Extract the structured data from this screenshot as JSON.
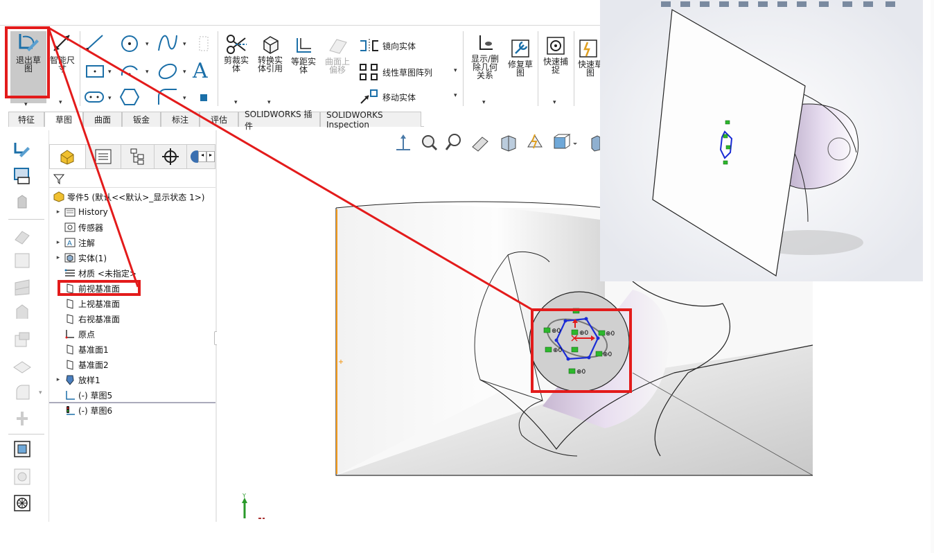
{
  "ribbon": {
    "exit_sketch": "退出草图",
    "smart_dimension": "智能尺寸",
    "trim": "剪裁实体",
    "convert": "转换实体引用",
    "offset": "等距实体",
    "offset_on_surface": "曲面上偏移",
    "mirror": "镜向实体",
    "linear_pattern": "线性草图阵列",
    "move": "移动实体",
    "show_delete_relations": "显示/删除几何关系",
    "repair_sketch": "修复草图",
    "quick_snaps": "快速捕捉",
    "rapid_sketch": "快速草图"
  },
  "tabs": [
    "特征",
    "草图",
    "曲面",
    "钣金",
    "标注",
    "评估",
    "SOLIDWORKS 插件",
    "SOLIDWORKS Inspection"
  ],
  "active_tab": "草图",
  "tree": {
    "root": "零件5  (默认<<默认>_显示状态 1>)",
    "items": [
      {
        "label": "History",
        "arrow": true
      },
      {
        "label": "传感器",
        "arrow": false
      },
      {
        "label": "注解",
        "arrow": true
      },
      {
        "label": "实体(1)",
        "arrow": true
      },
      {
        "label": "材质 <未指定>",
        "arrow": false
      },
      {
        "label": "前视基准面",
        "arrow": false
      },
      {
        "label": "上视基准面",
        "arrow": false
      },
      {
        "label": "右视基准面",
        "arrow": false
      },
      {
        "label": "原点",
        "arrow": false
      },
      {
        "label": "基准面1",
        "arrow": false
      },
      {
        "label": "基准面2",
        "arrow": false
      },
      {
        "label": "放样1",
        "arrow": true
      },
      {
        "label": "(-) 草图5",
        "arrow": false
      },
      {
        "label": "(-) 草图6",
        "arrow": false
      }
    ]
  },
  "axis": {
    "y": "Y"
  },
  "colors": {
    "highlight": "#e31b1b",
    "sketch": "#1a2bd6",
    "relation": "#2db82d",
    "surface": "#e7e2ea"
  }
}
